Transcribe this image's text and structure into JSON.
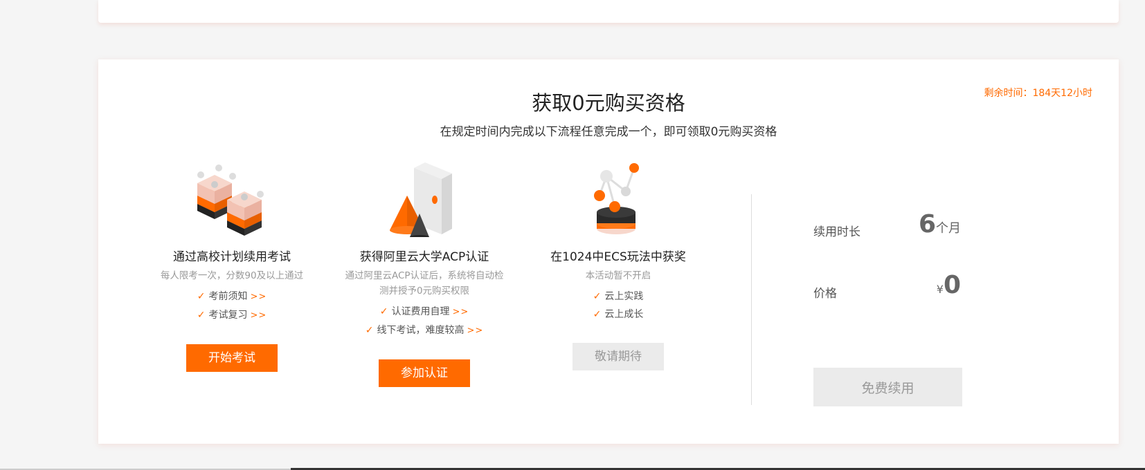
{
  "header": {
    "title": "获取0元购买资格",
    "subtitle": "在规定时间内完成以下流程任意完成一个，即可领取0元购买资格",
    "remaining": "剩余时间：184天12小时"
  },
  "options": [
    {
      "title": "通过高校计划续用考试",
      "desc": "每人限考一次，分数90及以上通过",
      "links": [
        {
          "label": "考前须知",
          "more": ">>"
        },
        {
          "label": "考试复习",
          "more": ">>"
        }
      ],
      "button": "开始考试"
    },
    {
      "title": "获得阿里云大学ACP认证",
      "desc": "通过阿里云ACP认证后，系统将自动检测并授予0元购买权限",
      "links": [
        {
          "label": "认证费用自理",
          "more": ">>"
        },
        {
          "label": "线下考试，难度较高",
          "more": ">>"
        }
      ],
      "button": "参加认证"
    },
    {
      "title": "在1024中ECS玩法中获奖",
      "desc": "本活动暂不开启",
      "links": [
        {
          "label": "云上实践",
          "more": ""
        },
        {
          "label": "云上成长",
          "more": ""
        }
      ],
      "button": "敬请期待"
    }
  ],
  "pricing": {
    "duration_label": "续用时长",
    "duration_value": "6",
    "duration_unit": "个月",
    "price_label": "价格",
    "price_currency": "¥",
    "price_value": "0",
    "renew_button": "免费续用"
  },
  "colors": {
    "accent": "#ff6a00",
    "disabled": "#ebebeb"
  },
  "icons": [
    "check-icon",
    "cube-blocks-illustration",
    "cone-box-illustration",
    "molecule-illustration"
  ]
}
